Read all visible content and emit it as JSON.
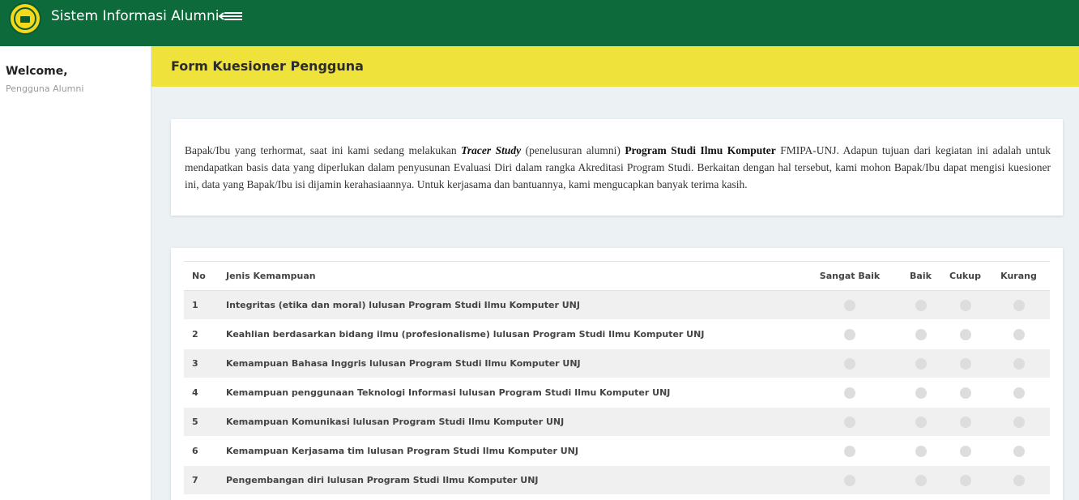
{
  "app": {
    "title": "Sistem Informasi Alumni"
  },
  "sidebar": {
    "welcome": "Welcome,",
    "user": "Pengguna Alumni"
  },
  "header": {
    "title": "Form Kuesioner Pengguna"
  },
  "intro": {
    "p1": "Bapak/Ibu yang terhormat, saat ini kami sedang melakukan ",
    "em": "Tracer Study",
    "p2": " (penelusuran alumni) ",
    "strong": "Program Studi Ilmu Komputer",
    "p3": " FMIPA-UNJ. Adapun tujuan dari kegiatan ini adalah untuk mendapatkan basis data yang diperlukan dalam penyusunan Evaluasi Diri dalam rangka Akreditasi Program Studi. Berkaitan dengan hal tersebut, kami mohon Bapak/Ibu dapat mengisi kuesioner ini, data yang Bapak/Ibu isi dijamin kerahasiaannya. Untuk kerjasama dan bantuannya, kami mengucapkan banyak terima kasih."
  },
  "table": {
    "headers": {
      "no": "No",
      "jenis": "Jenis Kemampuan",
      "sangat_baik": "Sangat Baik",
      "baik": "Baik",
      "cukup": "Cukup",
      "kurang": "Kurang"
    },
    "rows": [
      {
        "no": "1",
        "label": "Integritas (etika dan moral) lulusan Program Studi Ilmu Komputer UNJ"
      },
      {
        "no": "2",
        "label": "Keahlian berdasarkan bidang ilmu (profesionalisme) lulusan Program Studi Ilmu Komputer UNJ"
      },
      {
        "no": "3",
        "label": "Kemampuan Bahasa Inggris lulusan Program Studi Ilmu Komputer UNJ"
      },
      {
        "no": "4",
        "label": "Kemampuan penggunaan Teknologi Informasi lulusan Program Studi Ilmu Komputer UNJ"
      },
      {
        "no": "5",
        "label": "Kemampuan Komunikasi lulusan Program Studi Ilmu Komputer UNJ"
      },
      {
        "no": "6",
        "label": "Kemampuan Kerjasama tim lulusan Program Studi Ilmu Komputer UNJ"
      },
      {
        "no": "7",
        "label": "Pengembangan diri lulusan Program Studi Ilmu Komputer UNJ"
      }
    ]
  },
  "colors": {
    "topbar": "#0d6a3a",
    "header": "#efe23a",
    "logo": "#f3d81c",
    "radio": "#dddddd"
  },
  "icons": {
    "logo": "university-logo-icon",
    "menu": "menu-collapse-icon"
  }
}
